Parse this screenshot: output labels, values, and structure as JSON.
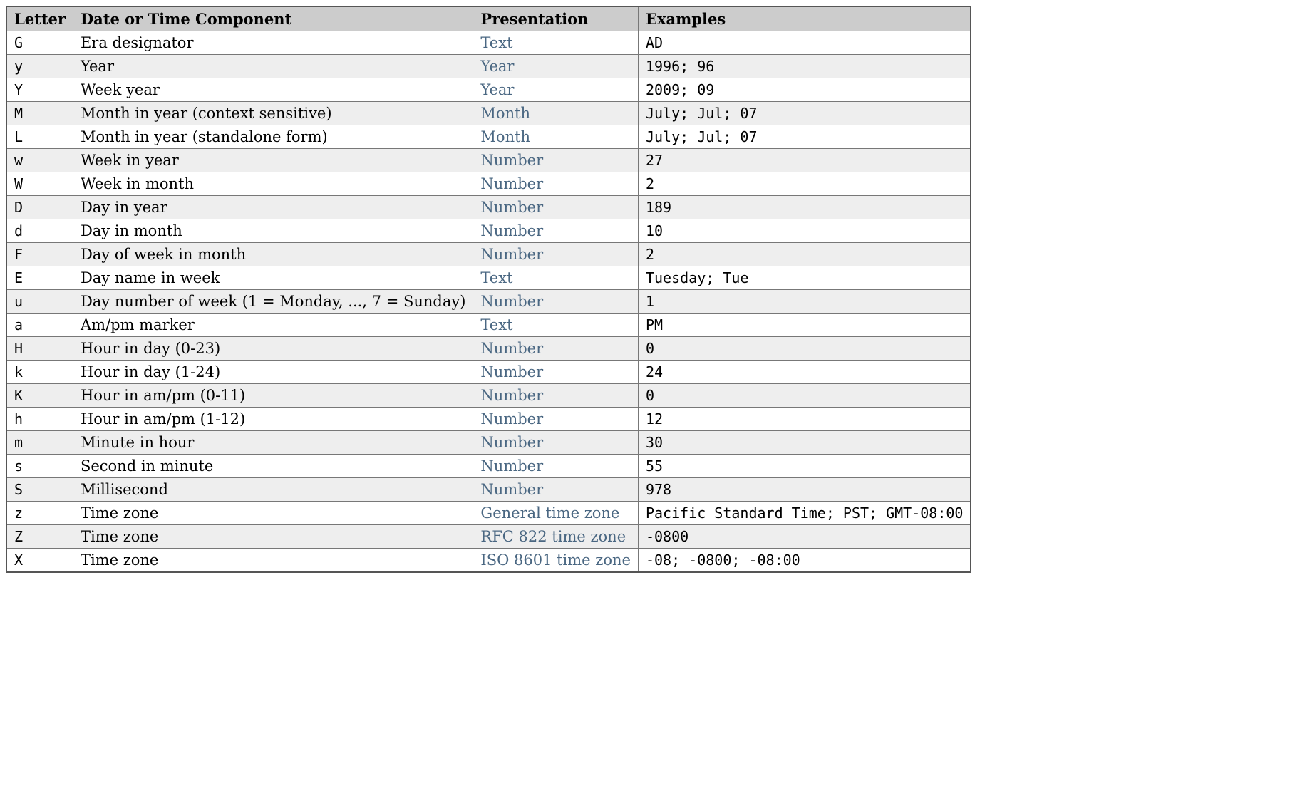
{
  "headers": {
    "letter": "Letter",
    "component": "Date or Time Component",
    "presentation": "Presentation",
    "examples": "Examples"
  },
  "rows": [
    {
      "letter": "G",
      "component": "Era designator",
      "presentation": "Text",
      "examples": "AD"
    },
    {
      "letter": "y",
      "component": "Year",
      "presentation": "Year",
      "examples": "1996; 96"
    },
    {
      "letter": "Y",
      "component": "Week year",
      "presentation": "Year",
      "examples": "2009; 09"
    },
    {
      "letter": "M",
      "component": "Month in year (context sensitive)",
      "presentation": "Month",
      "examples": "July; Jul; 07"
    },
    {
      "letter": "L",
      "component": "Month in year (standalone form)",
      "presentation": "Month",
      "examples": "July; Jul; 07"
    },
    {
      "letter": "w",
      "component": "Week in year",
      "presentation": "Number",
      "examples": "27"
    },
    {
      "letter": "W",
      "component": "Week in month",
      "presentation": "Number",
      "examples": "2"
    },
    {
      "letter": "D",
      "component": "Day in year",
      "presentation": "Number",
      "examples": "189"
    },
    {
      "letter": "d",
      "component": "Day in month",
      "presentation": "Number",
      "examples": "10"
    },
    {
      "letter": "F",
      "component": "Day of week in month",
      "presentation": "Number",
      "examples": "2"
    },
    {
      "letter": "E",
      "component": "Day name in week",
      "presentation": "Text",
      "examples": "Tuesday; Tue"
    },
    {
      "letter": "u",
      "component": "Day number of week (1 = Monday, ..., 7 = Sunday)",
      "presentation": "Number",
      "examples": "1"
    },
    {
      "letter": "a",
      "component": "Am/pm marker",
      "presentation": "Text",
      "examples": "PM"
    },
    {
      "letter": "H",
      "component": "Hour in day (0-23)",
      "presentation": "Number",
      "examples": "0"
    },
    {
      "letter": "k",
      "component": "Hour in day (1-24)",
      "presentation": "Number",
      "examples": "24"
    },
    {
      "letter": "K",
      "component": "Hour in am/pm (0-11)",
      "presentation": "Number",
      "examples": "0"
    },
    {
      "letter": "h",
      "component": "Hour in am/pm (1-12)",
      "presentation": "Number",
      "examples": "12"
    },
    {
      "letter": "m",
      "component": "Minute in hour",
      "presentation": "Number",
      "examples": "30"
    },
    {
      "letter": "s",
      "component": "Second in minute",
      "presentation": "Number",
      "examples": "55"
    },
    {
      "letter": "S",
      "component": "Millisecond",
      "presentation": "Number",
      "examples": "978"
    },
    {
      "letter": "z",
      "component": "Time zone",
      "presentation": "General time zone",
      "examples": "Pacific Standard Time; PST; GMT-08:00"
    },
    {
      "letter": "Z",
      "component": "Time zone",
      "presentation": "RFC 822 time zone",
      "examples": "-0800"
    },
    {
      "letter": "X",
      "component": "Time zone",
      "presentation": "ISO 8601 time zone",
      "examples": "-08; -0800; -08:00"
    }
  ]
}
